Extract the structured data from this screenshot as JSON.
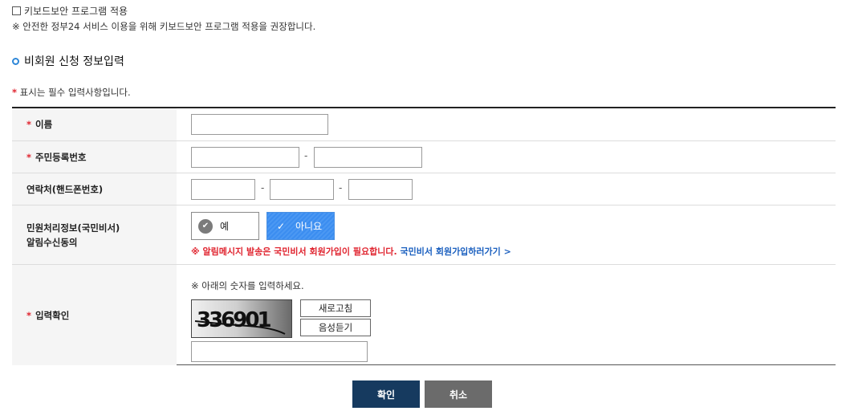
{
  "keyboard": {
    "checkbox_label": "키보드보안 프로그램 적용",
    "note": "※ 안전한 정부24 서비스 이용을 위해 키보드보안 프로그램 적용을 권장합니다."
  },
  "section": {
    "title": "비회원 신청 정보입력"
  },
  "required_note": {
    "mark": "*",
    "text": "표시는 필수 입력사항입니다."
  },
  "form": {
    "name": {
      "mark": "*",
      "label": "이름",
      "value": ""
    },
    "rrn": {
      "mark": "*",
      "label": "주민등록번호",
      "sep": "-",
      "first": "",
      "second": ""
    },
    "phone": {
      "label": "연락처(핸드폰번호)",
      "sep": "-",
      "p1": "",
      "p2": "",
      "p3": ""
    },
    "consent": {
      "label_line1": "민원처리정보(국민비서)",
      "label_line2": "알림수신동의",
      "yes": "예",
      "no": "아니요",
      "selected": "아니요",
      "alert_red": "※ 알림메시지 발송은 국민비서 회원가입이 필요합니다.",
      "alert_link": "국민비서 회원가입하러가기 >"
    },
    "captcha": {
      "mark": "*",
      "label": "입력확인",
      "note": "※ 아래의 숫자를 입력하세요.",
      "image_text": "336901",
      "refresh": "새로고침",
      "audio": "음성듣기",
      "value": ""
    }
  },
  "buttons": {
    "confirm": "확인",
    "cancel": "취소"
  },
  "colors": {
    "accent": "#2e87d8",
    "required": "#e0242f",
    "selected_bg": "#3b8df0",
    "confirm_bg": "#163a5f",
    "cancel_bg": "#6b6b6b"
  }
}
